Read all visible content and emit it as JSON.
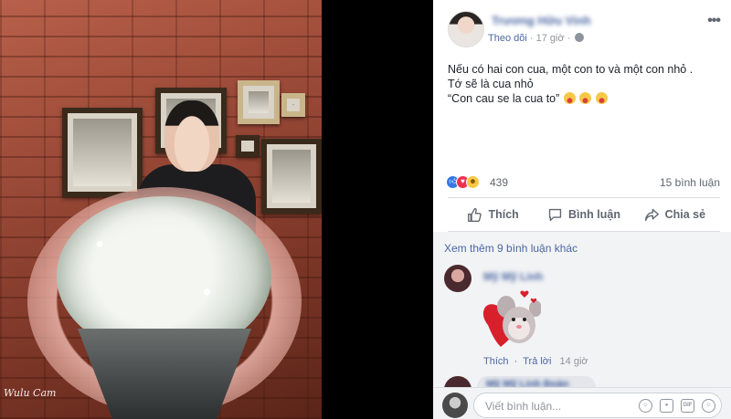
{
  "photo": {
    "watermark": "Wulu Cam"
  },
  "post": {
    "author": "Trương Hữu Vinh",
    "follow_label": "Theo dõi",
    "separator": "·",
    "time": "17 giờ",
    "privacy_icon": "globe-icon",
    "more_icon": "more-icon",
    "lines": [
      "Nếu có hai con cua, một con to và một con nhỏ .",
      "Tớ sẽ là cua nhỏ",
      "“Con cau se la cua to”"
    ]
  },
  "reactions": {
    "types": [
      "like",
      "love",
      "haha"
    ],
    "count": "439",
    "comments": "15 bình luận"
  },
  "actions": {
    "like": "Thích",
    "comment": "Bình luận",
    "share": "Chia sẻ"
  },
  "comments": {
    "view_more": "Xem thêm 9 bình luận khác",
    "first": {
      "name": "Mỹ Mỹ Linh",
      "sticker": "heart-mouse-sticker",
      "like_label": "Thích",
      "reply_label": "Trả lời",
      "time": "14 giờ"
    },
    "second": {
      "name": "Mỹ Mỹ Linh Đoàn"
    }
  },
  "compose": {
    "placeholder": "Viết bình luận...",
    "icons": [
      "emoji-icon",
      "camera-icon",
      "gif-icon",
      "sticker-icon"
    ]
  },
  "colors": {
    "link": "#4b67a1",
    "like_blue": "#3578e5",
    "love_red": "#f0314f",
    "haha_yellow": "#f7c846",
    "muted": "#90949c"
  }
}
